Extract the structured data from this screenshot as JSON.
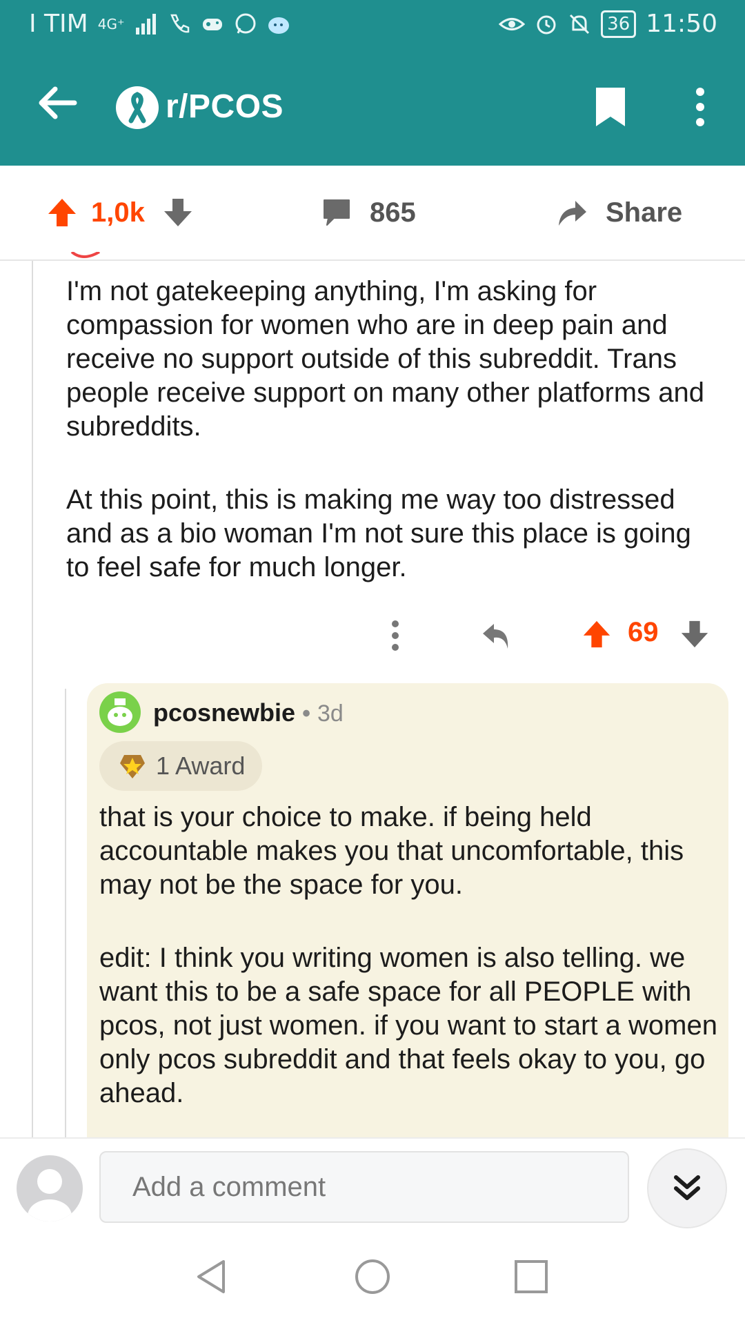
{
  "status_bar": {
    "carrier": "I TIM",
    "network": "4G⁺",
    "battery": "36",
    "time": "11:50"
  },
  "app_bar": {
    "subreddit": "r/PCOS"
  },
  "post_actions": {
    "upvotes": "1,0k",
    "comments": "865",
    "share_label": "Share"
  },
  "comment": {
    "paragraphs": [
      "I'm not gatekeeping anything, I'm asking for compassion for women who are in deep pain and receive no support outside of this subreddit. Trans people receive support on many other platforms and subreddits.",
      "At this point, this is making me way too distressed and as a bio woman I'm not sure this place is going to feel safe for much longer."
    ],
    "score": "69"
  },
  "reply": {
    "author": "pcosnewbie",
    "separator": "•",
    "age": "3d",
    "award_label": "1 Award",
    "paragraphs": [
      "that is your choice to make. if being held accountable makes you that uncomfortable, this may not be the space for you.",
      "edit: I think you writing women is also telling. we want this to be a safe space for all PEOPLE with pcos, not just women. if you want to start a women only pcos subreddit and that feels okay to you, go ahead."
    ]
  },
  "composer": {
    "placeholder": "Add a comment"
  },
  "colors": {
    "brand_teal": "#1f8f8f",
    "upvote_orange": "#ff4500",
    "reply_bg": "#f7f3e1"
  }
}
